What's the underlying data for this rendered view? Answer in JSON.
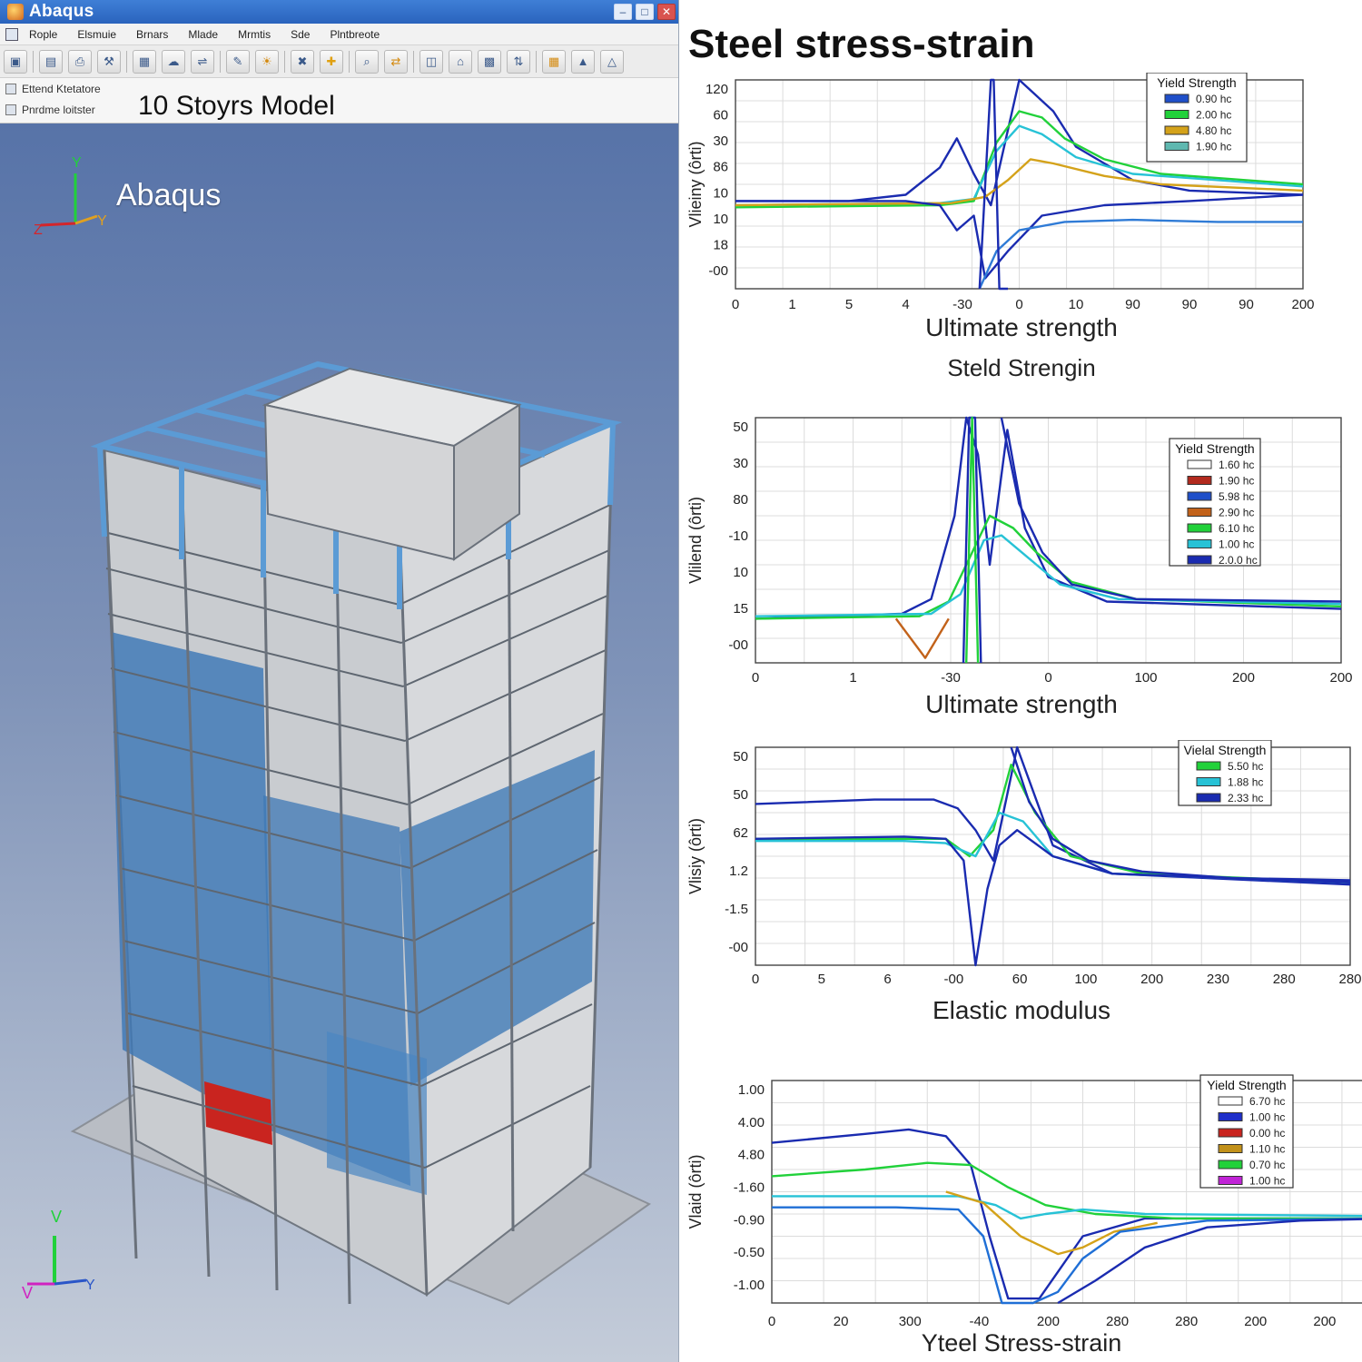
{
  "window": {
    "title": "Abaqus",
    "min": "–",
    "max": "□",
    "close": "✕"
  },
  "menu": {
    "items": [
      "Rople",
      "Elsmuie",
      "Brnars",
      "Mlade",
      "Mrmtis",
      "Sde",
      "Plntbreote"
    ]
  },
  "toolbar": {
    "icons": [
      "file-icon",
      "save-icon",
      "print-icon",
      "wrench-icon",
      "grid-icon",
      "cloud-icon",
      "pipe-icon",
      "edit-icon",
      "sun-icon",
      "cross-tools-icon",
      "plus-icon",
      "zoom-icon",
      "arrows-icon",
      "layer-icon",
      "house-icon",
      "mesh-icon",
      "load-icon",
      "table-icon",
      "chart-icon",
      "triangle-icon"
    ]
  },
  "model_tree": {
    "row1": "Ettend Ktetatore",
    "row2": "Pnrdme loitster"
  },
  "model_title": "10 Stoyrs Model",
  "viewport": {
    "label": "Abaqus",
    "triad_top": {
      "y": "Y",
      "z": "Z",
      "x": "Y"
    },
    "triad_bottom": {
      "y": "V",
      "z": "V",
      "x": "Y"
    }
  },
  "colors": {
    "accent_blue": "#3f7fd6",
    "glass_blue": "#3d78b6",
    "steel_blue": "#5b9bd5",
    "panel_red": "#c9241f",
    "navy": "#1a2bb0",
    "green": "#21d13a",
    "cyan": "#27c2d6",
    "gold": "#d4a21a"
  },
  "panel_title": "Steel stress-strain",
  "chart_data": [
    {
      "type": "line",
      "ylabel": "Vlieiny (ôrti)",
      "xlabel": "Ultimate strength",
      "subtitle": "Steld Strengin",
      "xticks": [
        "0",
        "1",
        "5",
        "4",
        "-30",
        "0",
        "10",
        "90",
        "90",
        "90",
        "200"
      ],
      "yticks": [
        "120",
        "60",
        "30",
        "86",
        "10",
        "10",
        "18",
        "-00"
      ],
      "legend_title": "Yield Strength",
      "legend": [
        {
          "label": "0.90 hc",
          "color": "#1f4fc9"
        },
        {
          "label": "2.00 hc",
          "color": "#21d13a"
        },
        {
          "label": "4.80 hc",
          "color": "#d4a21a"
        },
        {
          "label": "1.90 hc",
          "color": "#5fb8b0"
        }
      ],
      "series": [
        {
          "color": "#1a2bb0",
          "x": [
            0,
            2,
            3,
            3.6,
            3.9,
            4.2,
            4.5,
            5.0,
            5.6,
            6,
            7,
            8,
            10
          ],
          "y": [
            0.42,
            0.42,
            0.45,
            0.58,
            0.72,
            0.55,
            0.4,
            1.0,
            0.85,
            0.68,
            0.52,
            0.47,
            0.45
          ]
        },
        {
          "color": "#21d13a",
          "x": [
            0,
            3.6,
            4.2,
            4.6,
            5.0,
            5.4,
            5.8,
            6.5,
            7.5,
            10
          ],
          "y": [
            0.39,
            0.4,
            0.42,
            0.7,
            0.85,
            0.82,
            0.72,
            0.62,
            0.55,
            0.5
          ]
        },
        {
          "color": "#27c2d6",
          "x": [
            0,
            3.6,
            4.2,
            4.6,
            5.0,
            5.4,
            6,
            7,
            10
          ],
          "y": [
            0.4,
            0.41,
            0.43,
            0.66,
            0.78,
            0.74,
            0.63,
            0.55,
            0.49
          ]
        },
        {
          "color": "#d4a21a",
          "x": [
            0,
            3.8,
            4.4,
            4.8,
            5.2,
            5.6,
            6.5,
            7.5,
            10
          ],
          "y": [
            0.4,
            0.41,
            0.44,
            0.52,
            0.62,
            0.6,
            0.54,
            0.5,
            0.47
          ]
        },
        {
          "color": "#1a2bb0",
          "x": [
            0,
            3,
            3.6,
            3.9,
            4.2,
            4.4,
            4.8,
            5.4,
            6.5,
            8,
            10
          ],
          "y": [
            0.42,
            0.42,
            0.4,
            0.28,
            0.35,
            0.05,
            0.18,
            0.35,
            0.4,
            0.42,
            0.45
          ]
        },
        {
          "color": "#2f7bd6",
          "x": [
            4.3,
            4.6,
            5.0,
            5.8,
            7,
            8.5,
            10
          ],
          "y": [
            0.0,
            0.18,
            0.28,
            0.32,
            0.33,
            0.32,
            0.32
          ]
        },
        {
          "color": "#1a2bb0",
          "x": [
            4.3,
            4.5,
            4.55,
            4.65,
            4.8
          ],
          "y": [
            0.0,
            1.0,
            1.0,
            0.0,
            0.0
          ]
        }
      ]
    },
    {
      "type": "line",
      "ylabel": "Vlilend (ôrti)",
      "xlabel": "Ultimate strength",
      "xticks": [
        "0",
        "1",
        "-30",
        "0",
        "100",
        "200",
        "200"
      ],
      "yticks": [
        "50",
        "30",
        "80",
        "-10",
        "10",
        "15",
        "-00"
      ],
      "legend_title": "Yield Strength",
      "legend": [
        {
          "label": "1.60 hc",
          "color": "#ffffff"
        },
        {
          "label": "1.90 hc",
          "color": "#b22a1e"
        },
        {
          "label": "5.98 hc",
          "color": "#1f4fc9"
        },
        {
          "label": "2.90 hc",
          "color": "#c2621a"
        },
        {
          "label": "6.10 hc",
          "color": "#21d13a"
        },
        {
          "label": "1.00 hc",
          "color": "#27c2d6"
        },
        {
          "label": "2.0.0 hc",
          "color": "#1a2bb0"
        }
      ],
      "series": [
        {
          "color": "#1a2bb0",
          "x": [
            0,
            2.5,
            3.0,
            3.4,
            3.6,
            3.8,
            4.0,
            4.3,
            4.6,
            5,
            6,
            10
          ],
          "y": [
            0.18,
            0.2,
            0.26,
            0.6,
            1.0,
            0.85,
            0.4,
            0.95,
            0.55,
            0.35,
            0.25,
            0.22
          ]
        },
        {
          "color": "#21d13a",
          "x": [
            0,
            2.8,
            3.3,
            3.7,
            4.0,
            4.4,
            4.8,
            5.4,
            6.5,
            10
          ],
          "y": [
            0.18,
            0.19,
            0.25,
            0.45,
            0.6,
            0.55,
            0.45,
            0.33,
            0.26,
            0.23
          ]
        },
        {
          "color": "#27c2d6",
          "x": [
            0,
            3.0,
            3.5,
            3.9,
            4.2,
            4.6,
            5.2,
            6.2,
            10
          ],
          "y": [
            0.19,
            0.2,
            0.28,
            0.5,
            0.52,
            0.44,
            0.32,
            0.26,
            0.24
          ]
        },
        {
          "color": "#c2621a",
          "x": [
            2.4,
            2.9,
            3.1,
            3.3
          ],
          "y": [
            0.18,
            0.02,
            0.1,
            0.18
          ]
        },
        {
          "color": "#1a2bb0",
          "x": [
            3.55,
            3.65,
            3.75,
            3.85
          ],
          "y": [
            0.0,
            1.0,
            1.0,
            0.0
          ]
        },
        {
          "color": "#21d13a",
          "x": [
            3.6,
            3.7,
            3.8
          ],
          "y": [
            0.0,
            1.0,
            0.0
          ]
        },
        {
          "color": "#1a2bb0",
          "x": [
            4.2,
            4.5,
            4.9,
            5.4,
            6.5,
            10
          ],
          "y": [
            1.0,
            0.65,
            0.45,
            0.32,
            0.26,
            0.25
          ]
        }
      ]
    },
    {
      "type": "line",
      "ylabel": "Vlisiy (ôrti)",
      "xlabel": "Elastic modulus",
      "xticks": [
        "0",
        "5",
        "6",
        "-00",
        "60",
        "100",
        "200",
        "230",
        "280",
        "280"
      ],
      "yticks": [
        "50",
        "50",
        "62",
        "1.2",
        "-1.5",
        "-00"
      ],
      "legend_title": "Vielal Strength",
      "legend": [
        {
          "label": "5.50 hc",
          "color": "#21d13a"
        },
        {
          "label": "1.88 hc",
          "color": "#27c2d6"
        },
        {
          "label": "2.33 hc",
          "color": "#1a2bb0"
        }
      ],
      "series": [
        {
          "color": "#1a2bb0",
          "x": [
            0,
            2,
            3,
            3.4,
            3.7,
            4.0,
            4.4,
            5,
            6,
            10
          ],
          "y": [
            0.74,
            0.76,
            0.76,
            0.72,
            0.62,
            0.48,
            1.0,
            0.55,
            0.42,
            0.37
          ]
        },
        {
          "color": "#21d13a",
          "x": [
            0,
            2.5,
            3.2,
            3.6,
            4.0,
            4.3,
            4.7,
            5.3,
            6.5,
            10
          ],
          "y": [
            0.58,
            0.58,
            0.58,
            0.5,
            0.62,
            0.92,
            0.7,
            0.5,
            0.42,
            0.38
          ]
        },
        {
          "color": "#27c2d6",
          "x": [
            0,
            2.5,
            3.2,
            3.7,
            4.1,
            4.5,
            5.0,
            6,
            10
          ],
          "y": [
            0.57,
            0.57,
            0.56,
            0.5,
            0.7,
            0.66,
            0.5,
            0.42,
            0.38
          ]
        },
        {
          "color": "#1a2bb0",
          "x": [
            0,
            2.5,
            3.2,
            3.5,
            3.7,
            3.9,
            4.1,
            4.4,
            5,
            6,
            10
          ],
          "y": [
            0.58,
            0.59,
            0.58,
            0.48,
            0.0,
            0.35,
            0.55,
            0.62,
            0.5,
            0.42,
            0.38
          ]
        },
        {
          "color": "#1a2bb0",
          "x": [
            4.3,
            4.6,
            5.0,
            5.6,
            6.5,
            8,
            10
          ],
          "y": [
            1.0,
            0.75,
            0.58,
            0.48,
            0.43,
            0.4,
            0.39
          ]
        }
      ]
    },
    {
      "type": "line",
      "ylabel": "Vlaid (ôrti)",
      "xlabel": "Yteel Stress-strain",
      "xticks": [
        "0",
        "20",
        "300",
        "-40",
        "200",
        "280",
        "280",
        "200",
        "200",
        "200"
      ],
      "yticks": [
        "1.00",
        "4.00",
        "4.80",
        "-1.60",
        "-0.90",
        "-0.50",
        "-1.00"
      ],
      "legend_title": "Yield Strength",
      "legend": [
        {
          "label": "6.70 hc",
          "color": "#ffffff"
        },
        {
          "label": "1.00 hc",
          "color": "#1f2fc9"
        },
        {
          "label": "0.00 hc",
          "color": "#c9241f"
        },
        {
          "label": "1.10 hc",
          "color": "#c2911a"
        },
        {
          "label": "0.70 hc",
          "color": "#21d13a"
        },
        {
          "label": "1.00 hc",
          "color": "#c023d6"
        }
      ],
      "series": [
        {
          "color": "#1a2bb0",
          "x": [
            0,
            1.5,
            2.2,
            2.8,
            3.2,
            3.5,
            3.8,
            4.3,
            5,
            6,
            7,
            10
          ],
          "y": [
            0.72,
            0.76,
            0.78,
            0.75,
            0.62,
            0.3,
            0.02,
            0.02,
            0.3,
            0.38,
            0.38,
            0.38
          ]
        },
        {
          "color": "#21d13a",
          "x": [
            0,
            1.5,
            2.5,
            3.2,
            3.8,
            4.4,
            5.2,
            6.5,
            10
          ],
          "y": [
            0.57,
            0.6,
            0.63,
            0.62,
            0.52,
            0.44,
            0.4,
            0.38,
            0.38
          ]
        },
        {
          "color": "#27c2d6",
          "x": [
            0,
            2.2,
            3.0,
            3.6,
            4.0,
            4.4,
            5,
            6,
            10
          ],
          "y": [
            0.48,
            0.48,
            0.48,
            0.44,
            0.38,
            0.4,
            0.42,
            0.4,
            0.39
          ]
        },
        {
          "color": "#d4a21a",
          "x": [
            2.8,
            3.4,
            4.0,
            4.6,
            5.0,
            5.5,
            6.2
          ],
          "y": [
            0.5,
            0.45,
            0.3,
            0.22,
            0.25,
            0.32,
            0.36
          ]
        },
        {
          "color": "#1f6fd6",
          "x": [
            0,
            2.0,
            3.0,
            3.4,
            3.6,
            3.7,
            3.9,
            4.2,
            4.6,
            5.0,
            5.6,
            7,
            10
          ],
          "y": [
            0.43,
            0.43,
            0.42,
            0.3,
            0.1,
            0.0,
            0.0,
            0.0,
            0.05,
            0.2,
            0.32,
            0.37,
            0.38
          ]
        },
        {
          "color": "#1a2bb0",
          "x": [
            4.6,
            5.2,
            6.0,
            7.0,
            8.5,
            10
          ],
          "y": [
            0.0,
            0.1,
            0.25,
            0.34,
            0.37,
            0.38
          ]
        }
      ]
    }
  ]
}
